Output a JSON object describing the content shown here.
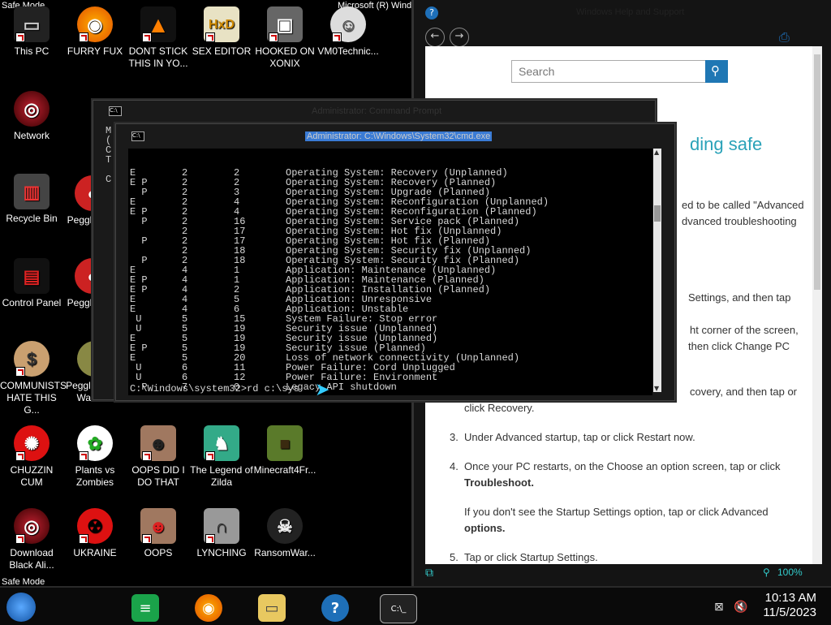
{
  "desktop": {
    "safe_mode_top": "Safe Mode",
    "safe_mode_bottom": "Safe Mode",
    "icons": [
      {
        "label": "This PC"
      },
      {
        "label": "FURRY FUX"
      },
      {
        "label": "DONT STICK THIS IN YO..."
      },
      {
        "label": "SEX EDITOR"
      },
      {
        "label": "HOOKED ON XONIX"
      },
      {
        "label": "VM0Technic..."
      },
      {
        "label": "Network"
      },
      {
        "label": "Recycle Bin"
      },
      {
        "label": "Control Panel"
      },
      {
        "label": "COMMUNISTS HATE THIS G..."
      },
      {
        "label": "CHUZZIN CUM"
      },
      {
        "label": "Plants vs Zombies"
      },
      {
        "label": "OOPS DID I DO THAT"
      },
      {
        "label": "The Legend of Zilda"
      },
      {
        "label": "Minecraft4Fr..."
      },
      {
        "label": "Download Black Ali..."
      },
      {
        "label": "UKRAINE"
      },
      {
        "label": "OOPS"
      },
      {
        "label": "LYNCHING"
      },
      {
        "label": "RansomWar..."
      },
      {
        "label": "Peggl"
      },
      {
        "label": "Peggl"
      },
      {
        "label": "Peggle Wo of Warcraft"
      }
    ],
    "top_right_label": "Microsoft (R) Wind"
  },
  "help_window": {
    "title": "Windows Help and Support",
    "search_placeholder": "Search",
    "heading_fragment": "ding safe",
    "lines": [
      "ed to be called \"Advanced",
      "dvanced troubleshooting",
      "Settings, and then tap",
      "ht corner of the screen,",
      "then click Change PC",
      "covery, and then tap or",
      "click Recovery."
    ],
    "step3": "Under Advanced startup, tap or click Restart now.",
    "step4a": "Once your PC restarts, on the Choose an option screen, tap or click",
    "step4b": "Troubleshoot.",
    "note1": "If you don't see the Startup Settings option, tap or click Advanced",
    "note2": "options.",
    "step5": "Tap or click Startup Settings.",
    "zoom": "100%"
  },
  "cmd_back": {
    "title": "Administrator: Command Prompt"
  },
  "cmd_front": {
    "title": "Administrator: C:\\Windows\\System32\\cmd.exe",
    "rows": [
      {
        "flag": "E",
        "maj": "2",
        "min": "2",
        "reason": "Operating System: Recovery (Unplanned)"
      },
      {
        "flag": "E P",
        "maj": "2",
        "min": "2",
        "reason": "Operating System: Recovery (Planned)"
      },
      {
        "flag": "  P",
        "maj": "2",
        "min": "3",
        "reason": "Operating System: Upgrade (Planned)"
      },
      {
        "flag": "E",
        "maj": "2",
        "min": "4",
        "reason": "Operating System: Reconfiguration (Unplanned)"
      },
      {
        "flag": "E P",
        "maj": "2",
        "min": "4",
        "reason": "Operating System: Reconfiguration (Planned)"
      },
      {
        "flag": "  P",
        "maj": "2",
        "min": "16",
        "reason": "Operating System: Service pack (Planned)"
      },
      {
        "flag": "",
        "maj": "2",
        "min": "17",
        "reason": "Operating System: Hot fix (Unplanned)"
      },
      {
        "flag": "  P",
        "maj": "2",
        "min": "17",
        "reason": "Operating System: Hot fix (Planned)"
      },
      {
        "flag": "",
        "maj": "2",
        "min": "18",
        "reason": "Operating System: Security fix (Unplanned)"
      },
      {
        "flag": "  P",
        "maj": "2",
        "min": "18",
        "reason": "Operating System: Security fix (Planned)"
      },
      {
        "flag": "E",
        "maj": "4",
        "min": "1",
        "reason": "Application: Maintenance (Unplanned)"
      },
      {
        "flag": "E P",
        "maj": "4",
        "min": "1",
        "reason": "Application: Maintenance (Planned)"
      },
      {
        "flag": "E P",
        "maj": "4",
        "min": "2",
        "reason": "Application: Installation (Planned)"
      },
      {
        "flag": "E",
        "maj": "4",
        "min": "5",
        "reason": "Application: Unresponsive"
      },
      {
        "flag": "E",
        "maj": "4",
        "min": "6",
        "reason": "Application: Unstable"
      },
      {
        "flag": " U",
        "maj": "5",
        "min": "15",
        "reason": "System Failure: Stop error"
      },
      {
        "flag": " U",
        "maj": "5",
        "min": "19",
        "reason": "Security issue (Unplanned)"
      },
      {
        "flag": "E",
        "maj": "5",
        "min": "19",
        "reason": "Security issue (Unplanned)"
      },
      {
        "flag": "E P",
        "maj": "5",
        "min": "19",
        "reason": "Security issue (Planned)"
      },
      {
        "flag": "E",
        "maj": "5",
        "min": "20",
        "reason": "Loss of network connectivity (Unplanned)"
      },
      {
        "flag": " U",
        "maj": "6",
        "min": "11",
        "reason": "Power Failure: Cord Unplugged"
      },
      {
        "flag": " U",
        "maj": "6",
        "min": "12",
        "reason": "Power Failure: Environment"
      },
      {
        "flag": "  P",
        "maj": "7",
        "min": "0",
        "reason": "Legacy API shutdown"
      }
    ],
    "prompt": "C:\\Windows\\system32>rd c:\\sys"
  },
  "taskbar": {
    "time": "10:13 AM",
    "date": "11/5/2023"
  },
  "colors": {
    "accent": "#2aa2b8",
    "search_button": "#1f77b4"
  }
}
